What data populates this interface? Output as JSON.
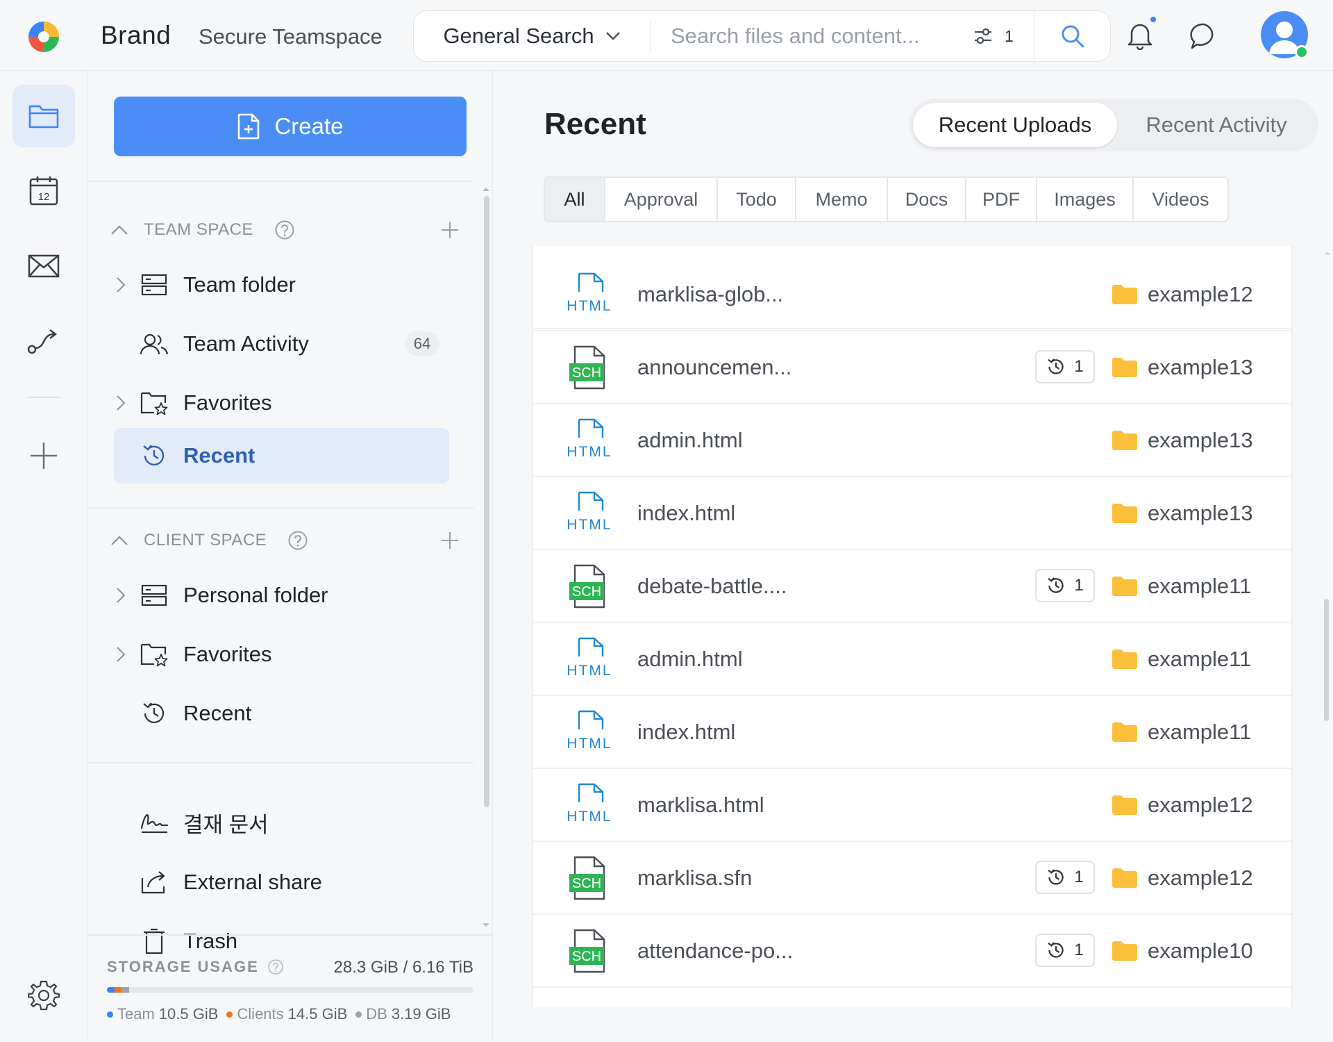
{
  "header": {
    "brand": "Brand",
    "workspace": "Secure Teamspace",
    "search_scope": "General Search",
    "search_placeholder": "Search files and content...",
    "filter_count": "1"
  },
  "sidebar": {
    "create_label": "Create",
    "team_space_title": "TEAM SPACE",
    "team_items": [
      {
        "label": "Team folder"
      },
      {
        "label": "Team Activity",
        "count": "64"
      },
      {
        "label": "Favorites"
      },
      {
        "label": "Recent"
      }
    ],
    "client_space_title": "CLIENT SPACE",
    "client_items": [
      {
        "label": "Personal folder"
      },
      {
        "label": "Favorites"
      },
      {
        "label": "Recent"
      }
    ],
    "other_items": [
      {
        "label": "결재 문서"
      },
      {
        "label": "External share"
      },
      {
        "label": "Trash"
      }
    ]
  },
  "storage": {
    "title": "STORAGE USAGE",
    "total": "28.3 GiB / 6.16 TiB",
    "legend": [
      {
        "name": "Team",
        "value": "10.5 GiB",
        "color": "#3b82f6"
      },
      {
        "name": "Clients",
        "value": "14.5 GiB",
        "color": "#f97316"
      },
      {
        "name": "DB",
        "value": "3.19 GiB",
        "color": "#9ca3af"
      }
    ]
  },
  "main": {
    "title": "Recent",
    "view_options": [
      "Recent Uploads",
      "Recent Activity"
    ],
    "active_view": "Recent Uploads",
    "filter_tabs": [
      "All",
      "Approval",
      "Todo",
      "Memo",
      "Docs",
      "PDF",
      "Images",
      "Videos"
    ],
    "active_filter": "All",
    "files": [
      {
        "type": "HTML",
        "name": "marklisa-glob...",
        "versions": "",
        "folder": "example12"
      },
      {
        "type": "SCH",
        "name": "announcemen...",
        "versions": "1",
        "folder": "example13"
      },
      {
        "type": "HTML",
        "name": "admin.html",
        "versions": "",
        "folder": "example13"
      },
      {
        "type": "HTML",
        "name": "index.html",
        "versions": "",
        "folder": "example13"
      },
      {
        "type": "SCH",
        "name": "debate-battle....",
        "versions": "1",
        "folder": "example11"
      },
      {
        "type": "HTML",
        "name": "admin.html",
        "versions": "",
        "folder": "example11"
      },
      {
        "type": "HTML",
        "name": "index.html",
        "versions": "",
        "folder": "example11"
      },
      {
        "type": "HTML",
        "name": "marklisa.html",
        "versions": "",
        "folder": "example12"
      },
      {
        "type": "SCH",
        "name": "marklisa.sfn",
        "versions": "1",
        "folder": "example12"
      },
      {
        "type": "SCH",
        "name": "attendance-po...",
        "versions": "1",
        "folder": "example10"
      }
    ]
  },
  "colors": {
    "accent": "#4a8ef5",
    "html_icon": "#1e88d6",
    "sch_icon": "#2fb556",
    "folder": "#fbbf3c",
    "active_bg": "#e3ebf9"
  }
}
